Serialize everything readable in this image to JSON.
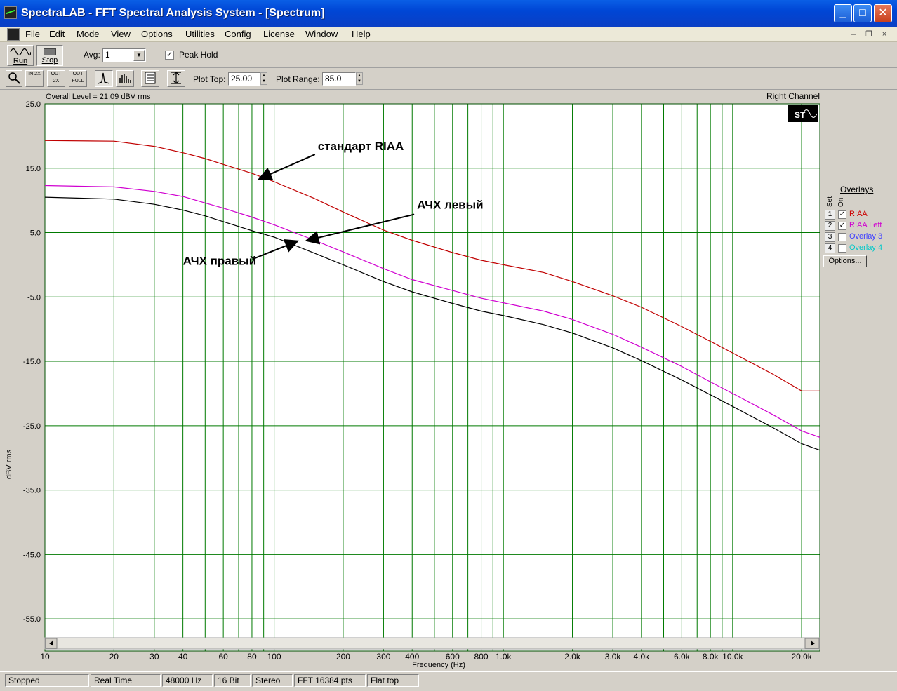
{
  "window": {
    "title": "SpectraLAB - FFT Spectral Analysis System - [Spectrum]",
    "minimize": "_",
    "maximize": "□",
    "close": "✕"
  },
  "menu": {
    "items": [
      "File",
      "Edit",
      "Mode",
      "View",
      "Options",
      "Utilities",
      "Config",
      "License",
      "Window",
      "Help"
    ],
    "mdi_min": "–",
    "mdi_restore": "❐",
    "mdi_close": "×"
  },
  "toolbar": {
    "run_label": "Run",
    "stop_label": "Stop",
    "avg_label": "Avg:",
    "avg_value": "1",
    "peak_hold_label": "Peak Hold",
    "peak_hold_checked": true,
    "plot_top_label": "Plot Top:",
    "plot_top_value": "25.00",
    "plot_range_label": "Plot Range:",
    "plot_range_value": "85.0",
    "zoom_in_label": "IN 2X",
    "zoom_out_label": "OUT 2X",
    "zoom_full_label": "OUT FULL"
  },
  "plot": {
    "overall_level": "Overall Level = 21.09 dBV rms",
    "channel": "Right Channel",
    "st_badge": "ST"
  },
  "overlays": {
    "title": "Overlays",
    "col_set": "Set",
    "col_on": "On",
    "items": [
      {
        "num": "1",
        "name": "RIAA",
        "checked": true,
        "color": "#cc0000"
      },
      {
        "num": "2",
        "name": "RIAA Left",
        "checked": true,
        "color": "#d000d0"
      },
      {
        "num": "3",
        "name": "Overlay 3",
        "checked": false,
        "color": "#4040ff"
      },
      {
        "num": "4",
        "name": "Overlay 4",
        "checked": false,
        "color": "#00c8c8"
      }
    ],
    "options_button": "Options..."
  },
  "status": {
    "cells": [
      "Stopped",
      "Real Time",
      "48000 Hz",
      "16 Bit",
      "Stereo",
      "FFT 16384 pts",
      "Flat top"
    ]
  },
  "chart_data": {
    "type": "line",
    "xlabel": "Frequency (Hz)",
    "ylabel": "dBV rms",
    "x_scale": "log",
    "xlim": [
      10,
      24000
    ],
    "ylim": [
      -60,
      25
    ],
    "grid": true,
    "y_ticks": [
      "25.0",
      "15.0",
      "5.0",
      "-5.0",
      "-15.0",
      "-25.0",
      "-35.0",
      "-45.0",
      "-55.0"
    ],
    "x_tick_labels": [
      {
        "v": 10,
        "t": "10"
      },
      {
        "v": 20,
        "t": "20"
      },
      {
        "v": 30,
        "t": "30"
      },
      {
        "v": 40,
        "t": "40"
      },
      {
        "v": 60,
        "t": "60"
      },
      {
        "v": 80,
        "t": "80"
      },
      {
        "v": 100,
        "t": "100"
      },
      {
        "v": 200,
        "t": "200"
      },
      {
        "v": 300,
        "t": "300"
      },
      {
        "v": 400,
        "t": "400"
      },
      {
        "v": 600,
        "t": "600"
      },
      {
        "v": 800,
        "t": "800"
      },
      {
        "v": 1000,
        "t": "1.0k"
      },
      {
        "v": 2000,
        "t": "2.0k"
      },
      {
        "v": 3000,
        "t": "3.0k"
      },
      {
        "v": 4000,
        "t": "4.0k"
      },
      {
        "v": 6000,
        "t": "6.0k"
      },
      {
        "v": 8000,
        "t": "8.0k"
      },
      {
        "v": 10000,
        "t": "10.0k"
      },
      {
        "v": 20000,
        "t": "20.0k"
      }
    ],
    "series": [
      {
        "name": "RIAA",
        "color": "#c00000",
        "points": [
          [
            10,
            19.3
          ],
          [
            20,
            19.2
          ],
          [
            30,
            18.4
          ],
          [
            40,
            17.4
          ],
          [
            50,
            16.5
          ],
          [
            60,
            15.6
          ],
          [
            80,
            14.2
          ],
          [
            100,
            12.9
          ],
          [
            150,
            10.3
          ],
          [
            200,
            8.2
          ],
          [
            300,
            5.4
          ],
          [
            400,
            3.8
          ],
          [
            600,
            1.9
          ],
          [
            800,
            0.7
          ],
          [
            1000,
            0.0
          ],
          [
            1500,
            -1.2
          ],
          [
            2000,
            -2.6
          ],
          [
            3000,
            -4.8
          ],
          [
            4000,
            -6.6
          ],
          [
            6000,
            -9.6
          ],
          [
            8000,
            -11.9
          ],
          [
            10000,
            -13.7
          ],
          [
            15000,
            -17.0
          ],
          [
            20000,
            -19.6
          ],
          [
            24000,
            -19.6
          ]
        ]
      },
      {
        "name": "RIAA Left",
        "color": "#d000d0",
        "points": [
          [
            10,
            12.3
          ],
          [
            20,
            12.1
          ],
          [
            30,
            11.4
          ],
          [
            40,
            10.6
          ],
          [
            50,
            9.6
          ],
          [
            60,
            8.8
          ],
          [
            80,
            7.4
          ],
          [
            100,
            6.2
          ],
          [
            150,
            3.8
          ],
          [
            200,
            2.0
          ],
          [
            300,
            -0.6
          ],
          [
            400,
            -2.3
          ],
          [
            600,
            -4.0
          ],
          [
            800,
            -5.2
          ],
          [
            1000,
            -5.9
          ],
          [
            1500,
            -7.2
          ],
          [
            2000,
            -8.5
          ],
          [
            3000,
            -10.8
          ],
          [
            4000,
            -12.8
          ],
          [
            6000,
            -15.8
          ],
          [
            8000,
            -18.2
          ],
          [
            10000,
            -20.0
          ],
          [
            15000,
            -23.3
          ],
          [
            20000,
            -25.8
          ],
          [
            24000,
            -26.8
          ]
        ]
      },
      {
        "color": "#000000",
        "points": [
          [
            10,
            10.5
          ],
          [
            20,
            10.2
          ],
          [
            30,
            9.4
          ],
          [
            40,
            8.5
          ],
          [
            50,
            7.6
          ],
          [
            60,
            6.7
          ],
          [
            80,
            5.3
          ],
          [
            100,
            4.3
          ],
          [
            150,
            1.8
          ],
          [
            200,
            0.0
          ],
          [
            300,
            -2.6
          ],
          [
            400,
            -4.2
          ],
          [
            600,
            -6.0
          ],
          [
            800,
            -7.2
          ],
          [
            1000,
            -7.9
          ],
          [
            1500,
            -9.3
          ],
          [
            2000,
            -10.6
          ],
          [
            3000,
            -12.9
          ],
          [
            4000,
            -14.9
          ],
          [
            6000,
            -17.9
          ],
          [
            8000,
            -20.2
          ],
          [
            10000,
            -22.0
          ],
          [
            15000,
            -25.3
          ],
          [
            20000,
            -27.8
          ],
          [
            24000,
            -28.8
          ]
        ]
      }
    ],
    "annotations": [
      {
        "text": "стандарт RIAA",
        "x": 155,
        "y": 17.8,
        "tip_x": 87,
        "tip_y": 13.4
      },
      {
        "text": "АЧХ левый",
        "x": 420,
        "y": 8.7,
        "tip_x": 140,
        "tip_y": 3.8
      },
      {
        "text": "АЧХ правый",
        "x": 40,
        "y": 0.0,
        "tip_x": 125,
        "tip_y": 3.6
      }
    ]
  }
}
